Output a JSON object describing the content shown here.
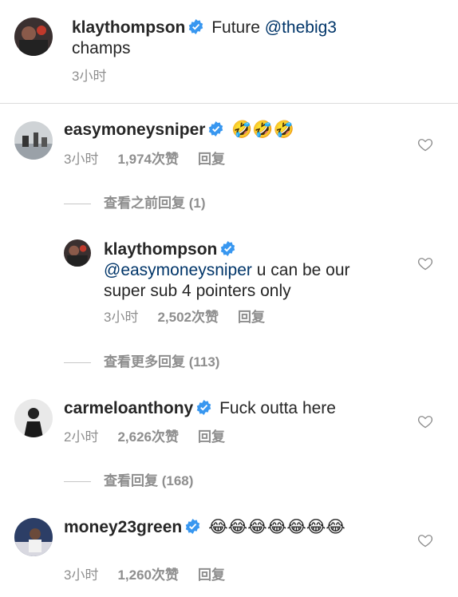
{
  "caption": {
    "username": "klaythompson",
    "text_before": "Future",
    "mention": "@thebig3",
    "text_after": "champs",
    "time": "3小时"
  },
  "comments": [
    {
      "username": "easymoneysniper",
      "emoji": "🤣🤣🤣",
      "time": "3小时",
      "likes": "1,974次赞",
      "reply_label": "回复",
      "view_replies": "查看之前回复 (1)"
    },
    {
      "username": "klaythompson",
      "mention": "@easymoneysniper",
      "text": "u can be our super sub 4 pointers only",
      "time": "3小时",
      "likes": "2,502次赞",
      "reply_label": "回复",
      "view_replies": "查看更多回复 (113)"
    },
    {
      "username": "carmeloanthony",
      "text": "Fuck outta here",
      "time": "2小时",
      "likes": "2,626次赞",
      "reply_label": "回复",
      "view_replies": "查看回复 (168)"
    },
    {
      "username": "money23green",
      "emoji": "😂😂😂😂😂😂😂",
      "time": "3小时",
      "likes": "1,260次赞",
      "reply_label": "回复"
    }
  ],
  "colors": {
    "text": "#262626",
    "secondary": "#8e8e8e",
    "mention": "#003569",
    "verified": "#3897f0",
    "divider": "#dbdbdb"
  },
  "icons": [
    "verified-badge-icon",
    "heart-icon"
  ]
}
